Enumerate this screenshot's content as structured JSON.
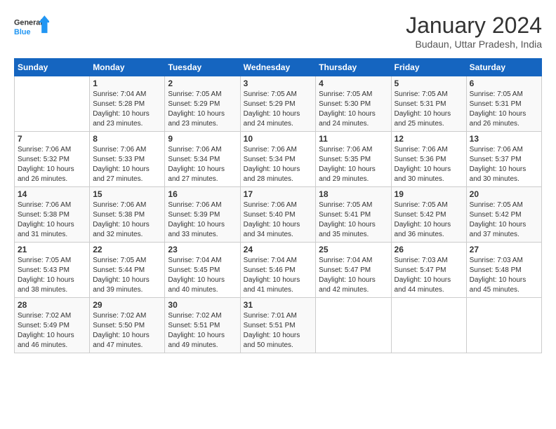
{
  "logo": {
    "line1": "General",
    "line2": "Blue"
  },
  "title": "January 2024",
  "subtitle": "Budaun, Uttar Pradesh, India",
  "days_header": [
    "Sunday",
    "Monday",
    "Tuesday",
    "Wednesday",
    "Thursday",
    "Friday",
    "Saturday"
  ],
  "weeks": [
    [
      {
        "num": "",
        "info": ""
      },
      {
        "num": "1",
        "info": "Sunrise: 7:04 AM\nSunset: 5:28 PM\nDaylight: 10 hours\nand 23 minutes."
      },
      {
        "num": "2",
        "info": "Sunrise: 7:05 AM\nSunset: 5:29 PM\nDaylight: 10 hours\nand 23 minutes."
      },
      {
        "num": "3",
        "info": "Sunrise: 7:05 AM\nSunset: 5:29 PM\nDaylight: 10 hours\nand 24 minutes."
      },
      {
        "num": "4",
        "info": "Sunrise: 7:05 AM\nSunset: 5:30 PM\nDaylight: 10 hours\nand 24 minutes."
      },
      {
        "num": "5",
        "info": "Sunrise: 7:05 AM\nSunset: 5:31 PM\nDaylight: 10 hours\nand 25 minutes."
      },
      {
        "num": "6",
        "info": "Sunrise: 7:05 AM\nSunset: 5:31 PM\nDaylight: 10 hours\nand 26 minutes."
      }
    ],
    [
      {
        "num": "7",
        "info": "Sunrise: 7:06 AM\nSunset: 5:32 PM\nDaylight: 10 hours\nand 26 minutes."
      },
      {
        "num": "8",
        "info": "Sunrise: 7:06 AM\nSunset: 5:33 PM\nDaylight: 10 hours\nand 27 minutes."
      },
      {
        "num": "9",
        "info": "Sunrise: 7:06 AM\nSunset: 5:34 PM\nDaylight: 10 hours\nand 27 minutes."
      },
      {
        "num": "10",
        "info": "Sunrise: 7:06 AM\nSunset: 5:34 PM\nDaylight: 10 hours\nand 28 minutes."
      },
      {
        "num": "11",
        "info": "Sunrise: 7:06 AM\nSunset: 5:35 PM\nDaylight: 10 hours\nand 29 minutes."
      },
      {
        "num": "12",
        "info": "Sunrise: 7:06 AM\nSunset: 5:36 PM\nDaylight: 10 hours\nand 30 minutes."
      },
      {
        "num": "13",
        "info": "Sunrise: 7:06 AM\nSunset: 5:37 PM\nDaylight: 10 hours\nand 30 minutes."
      }
    ],
    [
      {
        "num": "14",
        "info": "Sunrise: 7:06 AM\nSunset: 5:38 PM\nDaylight: 10 hours\nand 31 minutes."
      },
      {
        "num": "15",
        "info": "Sunrise: 7:06 AM\nSunset: 5:38 PM\nDaylight: 10 hours\nand 32 minutes."
      },
      {
        "num": "16",
        "info": "Sunrise: 7:06 AM\nSunset: 5:39 PM\nDaylight: 10 hours\nand 33 minutes."
      },
      {
        "num": "17",
        "info": "Sunrise: 7:06 AM\nSunset: 5:40 PM\nDaylight: 10 hours\nand 34 minutes."
      },
      {
        "num": "18",
        "info": "Sunrise: 7:05 AM\nSunset: 5:41 PM\nDaylight: 10 hours\nand 35 minutes."
      },
      {
        "num": "19",
        "info": "Sunrise: 7:05 AM\nSunset: 5:42 PM\nDaylight: 10 hours\nand 36 minutes."
      },
      {
        "num": "20",
        "info": "Sunrise: 7:05 AM\nSunset: 5:42 PM\nDaylight: 10 hours\nand 37 minutes."
      }
    ],
    [
      {
        "num": "21",
        "info": "Sunrise: 7:05 AM\nSunset: 5:43 PM\nDaylight: 10 hours\nand 38 minutes."
      },
      {
        "num": "22",
        "info": "Sunrise: 7:05 AM\nSunset: 5:44 PM\nDaylight: 10 hours\nand 39 minutes."
      },
      {
        "num": "23",
        "info": "Sunrise: 7:04 AM\nSunset: 5:45 PM\nDaylight: 10 hours\nand 40 minutes."
      },
      {
        "num": "24",
        "info": "Sunrise: 7:04 AM\nSunset: 5:46 PM\nDaylight: 10 hours\nand 41 minutes."
      },
      {
        "num": "25",
        "info": "Sunrise: 7:04 AM\nSunset: 5:47 PM\nDaylight: 10 hours\nand 42 minutes."
      },
      {
        "num": "26",
        "info": "Sunrise: 7:03 AM\nSunset: 5:47 PM\nDaylight: 10 hours\nand 44 minutes."
      },
      {
        "num": "27",
        "info": "Sunrise: 7:03 AM\nSunset: 5:48 PM\nDaylight: 10 hours\nand 45 minutes."
      }
    ],
    [
      {
        "num": "28",
        "info": "Sunrise: 7:02 AM\nSunset: 5:49 PM\nDaylight: 10 hours\nand 46 minutes."
      },
      {
        "num": "29",
        "info": "Sunrise: 7:02 AM\nSunset: 5:50 PM\nDaylight: 10 hours\nand 47 minutes."
      },
      {
        "num": "30",
        "info": "Sunrise: 7:02 AM\nSunset: 5:51 PM\nDaylight: 10 hours\nand 49 minutes."
      },
      {
        "num": "31",
        "info": "Sunrise: 7:01 AM\nSunset: 5:51 PM\nDaylight: 10 hours\nand 50 minutes."
      },
      {
        "num": "",
        "info": ""
      },
      {
        "num": "",
        "info": ""
      },
      {
        "num": "",
        "info": ""
      }
    ]
  ]
}
